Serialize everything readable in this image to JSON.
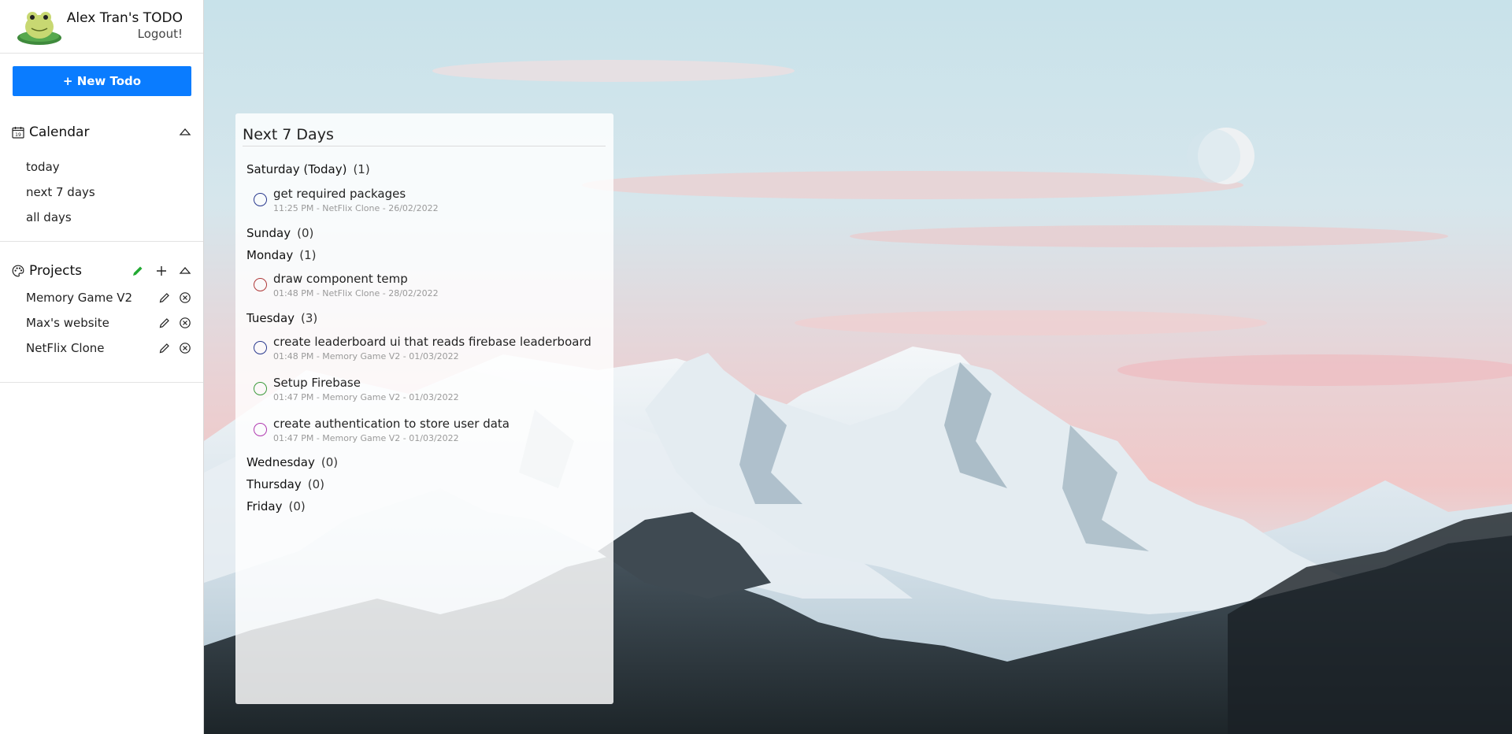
{
  "user": {
    "title": "Alex Tran's TODO",
    "logout_label": "Logout!"
  },
  "new_todo_label": "+ New Todo",
  "calendar": {
    "title": "Calendar",
    "items": [
      {
        "label": "today"
      },
      {
        "label": "next 7 days"
      },
      {
        "label": "all days"
      }
    ]
  },
  "projects": {
    "title": "Projects",
    "items": [
      {
        "name": "Memory Game V2"
      },
      {
        "name": "Max's website"
      },
      {
        "name": "NetFlix Clone"
      }
    ]
  },
  "panel": {
    "title": "Next 7 Days",
    "days": [
      {
        "label": "Saturday (Today)",
        "count": "(1)"
      },
      {
        "label": "Sunday",
        "count": "(0)"
      },
      {
        "label": "Monday",
        "count": "(1)"
      },
      {
        "label": "Tuesday",
        "count": "(3)"
      },
      {
        "label": "Wednesday",
        "count": "(0)"
      },
      {
        "label": "Thursday",
        "count": "(0)"
      },
      {
        "label": "Friday",
        "count": "(0)"
      }
    ],
    "todos": [
      {
        "text": "get required packages",
        "meta": "11:25 PM - NetFlix Clone - 26/02/2022",
        "color": "#2a3a8f"
      },
      {
        "text": "draw component temp",
        "meta": "01:48 PM - NetFlix Clone - 28/02/2022",
        "color": "#b03a3a"
      },
      {
        "text": "create leaderboard ui that reads firebase leaderboard",
        "meta": "01:48 PM - Memory Game V2 - 01/03/2022",
        "color": "#2a3a8f"
      },
      {
        "text": "Setup Firebase",
        "meta": "01:47 PM - Memory Game V2 - 01/03/2022",
        "color": "#3c9a3c"
      },
      {
        "text": "create authentication to store user data",
        "meta": "01:47 PM - Memory Game V2 - 01/03/2022",
        "color": "#b03ab0"
      }
    ]
  },
  "colors": {
    "accent": "#0a7cff",
    "project_edit": "#22aa33"
  }
}
